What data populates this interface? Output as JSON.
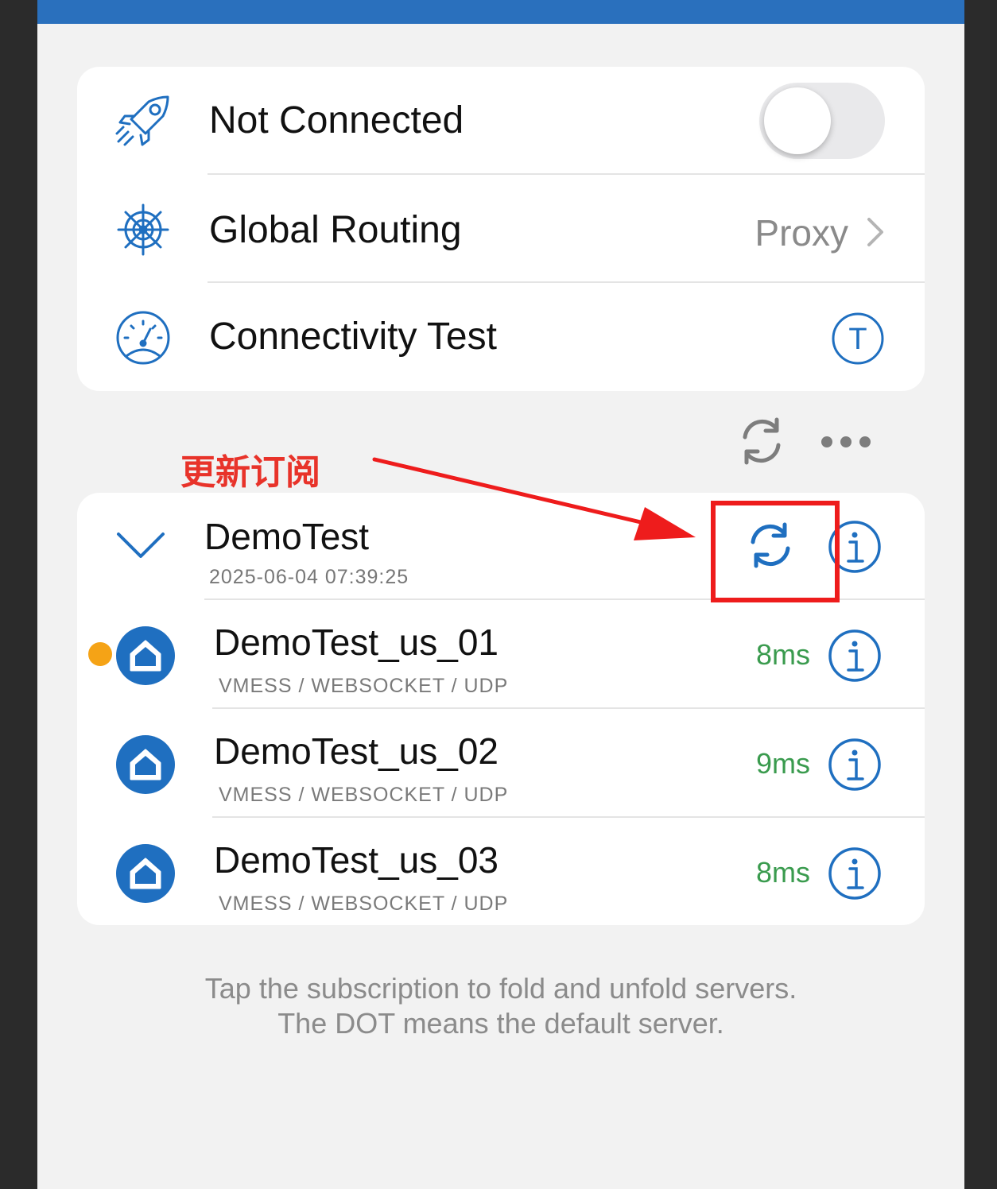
{
  "status": {
    "label": "Not Connected",
    "connected": false
  },
  "routing": {
    "label": "Global Routing",
    "value": "Proxy"
  },
  "connectivity": {
    "label": "Connectivity Test",
    "button_letter": "T"
  },
  "annotation": {
    "text": "更新订阅"
  },
  "subscription": {
    "name": "DemoTest",
    "updated": "2025-06-04 07:39:25",
    "servers": [
      {
        "name": "DemoTest_us_01",
        "protocol": "VMESS / WEBSOCKET / UDP",
        "latency": "8ms",
        "default": true
      },
      {
        "name": "DemoTest_us_02",
        "protocol": "VMESS / WEBSOCKET / UDP",
        "latency": "9ms",
        "default": false
      },
      {
        "name": "DemoTest_us_03",
        "protocol": "VMESS / WEBSOCKET / UDP",
        "latency": "8ms",
        "default": false
      }
    ]
  },
  "hint": {
    "line1": "Tap the subscription to fold and unfold servers.",
    "line2": "The DOT means the default server."
  },
  "colors": {
    "accent": "#1f6fc0",
    "latency": "#3a9b4e",
    "annotation": "#ee1c1c",
    "default_dot": "#f5a316"
  }
}
